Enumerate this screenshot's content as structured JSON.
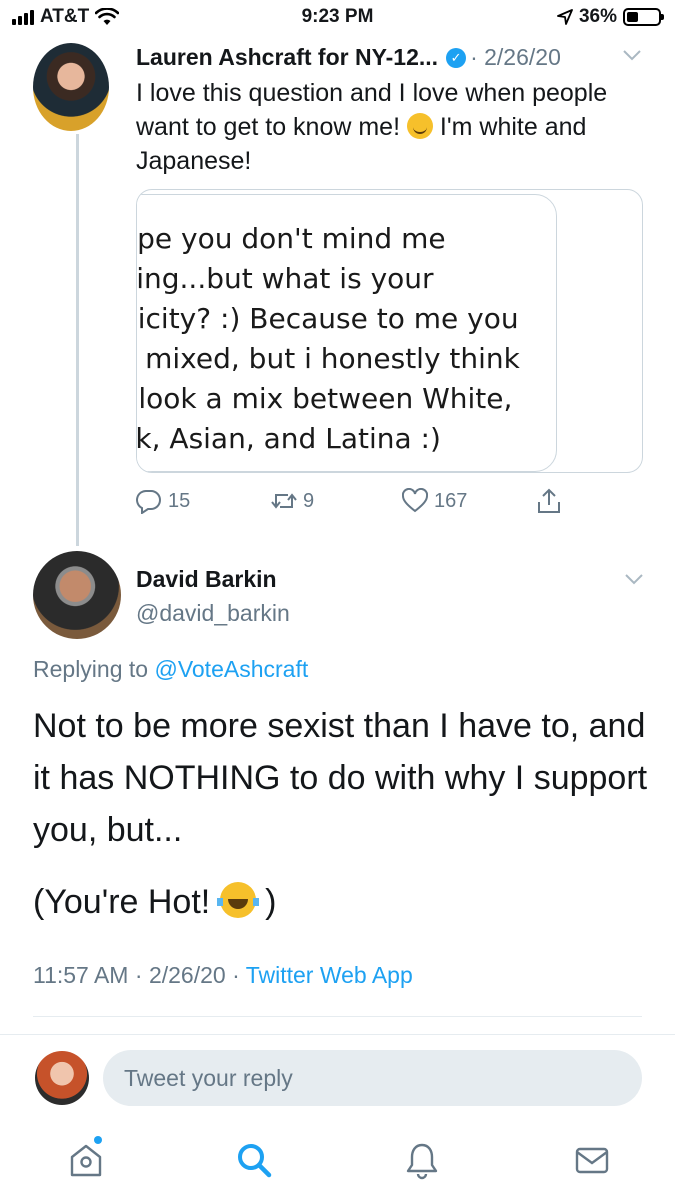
{
  "status_bar": {
    "carrier": "AT&T",
    "time": "9:23 PM",
    "battery": "36%"
  },
  "parent_tweet": {
    "name": "Lauren Ashcraft for NY-12...",
    "date": "2/26/20",
    "text_before_emoji": "I love this question and I love when people want to get to know me! ",
    "text_after_emoji": " I'm white and Japanese!",
    "media_lines": [
      "ope you don't mind me",
      "king...but what is your",
      "nicity? :) Because to me you",
      "k mixed, but i honestly think",
      "ι look a mix between White,",
      "ck, Asian, and Latina :)"
    ],
    "replies": "15",
    "retweets": "9",
    "likes": "167"
  },
  "main_tweet": {
    "name": "David Barkin",
    "handle": "@david_barkin",
    "replying_prefix": "Replying to ",
    "replying_to": "@VoteAshcraft",
    "text_p1": "Not to be more sexist than I have to, and it has NOTHING to do with why I support you, but...",
    "text_p2_before": "(You're Hot! ",
    "text_p2_after": " )",
    "time": "11:57 AM",
    "date": "2/26/20",
    "source": "Twitter Web App"
  },
  "reply_bar": {
    "placeholder": "Tweet your reply"
  },
  "colors": {
    "accent": "#1da1f2",
    "muted": "#657786",
    "divider": "#e6ecf0"
  },
  "icons": [
    "wifi-icon",
    "location-arrow-icon",
    "verified-icon",
    "chevron-down-icon",
    "reply-icon",
    "retweet-icon",
    "like-icon",
    "share-icon",
    "home-icon",
    "search-icon",
    "notifications-icon",
    "messages-icon"
  ]
}
